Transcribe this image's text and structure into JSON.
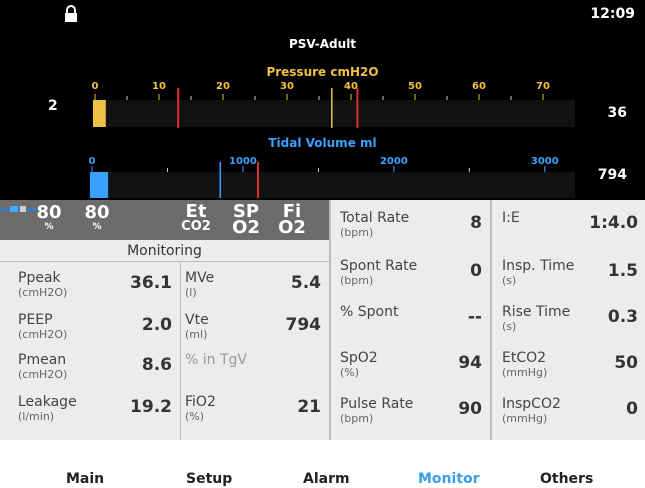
{
  "status": {
    "time": "12:09",
    "lock_icon": "lock-icon"
  },
  "mode": "PSV-Adult",
  "pressure_gauge": {
    "title": "Pressure cmH2O",
    "left_value": "2",
    "right_value": "36",
    "ticks": [
      "0",
      "10",
      "20",
      "30",
      "40",
      "50",
      "60",
      "70"
    ],
    "scale_max": 75,
    "bar_value": 2,
    "markers": [
      13,
      41
    ],
    "current_marker": 37,
    "color": "#f0c040",
    "marker_color": "#e03030"
  },
  "volume_gauge": {
    "title": "Tidal Volume ml",
    "right_value": "794",
    "ticks": [
      "0",
      "1000",
      "2000",
      "3000"
    ],
    "scale_max": 3200,
    "bar_value": 120,
    "markers": [
      1100
    ],
    "current_marker": 850,
    "color": "#3aa0ff",
    "marker_color": "#e03030"
  },
  "quickbar": {
    "item1": {
      "value": "80",
      "unit": "%"
    },
    "item2": {
      "value": "80",
      "unit": "%"
    },
    "sensor_icon": "sensor-icon",
    "etco2": {
      "top": "Et",
      "bottom": "CO2"
    },
    "spo2": {
      "top": "SP",
      "bottom": "O2"
    },
    "fio2": {
      "top": "Fi",
      "bottom": "O2"
    }
  },
  "monitoring_title": "Monitoring",
  "left_cells": {
    "ppeak": {
      "label": "Ppeak",
      "unit": "(cmH2O)",
      "value": "36.1"
    },
    "peep": {
      "label": "PEEP",
      "unit": "(cmH2O)",
      "value": "2.0"
    },
    "pmean": {
      "label": "Pmean",
      "unit": "(cmH2O)",
      "value": "8.6"
    },
    "leakage": {
      "label": "Leakage",
      "unit": "(l/min)",
      "value": "19.2"
    },
    "mve": {
      "label": "MVe",
      "unit": "(l)",
      "value": "5.4"
    },
    "vte": {
      "label": "Vte",
      "unit": "(ml)",
      "value": "794"
    },
    "tgv": {
      "label": "% in TgV",
      "unit": "",
      "value": ""
    },
    "fio2": {
      "label": "FiO2",
      "unit": "(%)",
      "value": "21"
    }
  },
  "mid_cells": {
    "total_rate": {
      "label": "Total Rate",
      "unit": "(bpm)",
      "value": "8"
    },
    "spont_rate": {
      "label": "Spont Rate",
      "unit": "(bpm)",
      "value": "0"
    },
    "pct_spont": {
      "label": "% Spont",
      "unit": "",
      "value": "--"
    },
    "spo2": {
      "label": "SpO2",
      "unit": "(%)",
      "value": "94"
    },
    "pulse_rate": {
      "label": "Pulse Rate",
      "unit": "(bpm)",
      "value": "90"
    }
  },
  "right_cells": {
    "ie": {
      "label": "I:E",
      "unit": "",
      "value": "1:4.0"
    },
    "insp_time": {
      "label": "Insp. Time",
      "unit": "(s)",
      "value": "1.5"
    },
    "rise_time": {
      "label": "Rise Time",
      "unit": "(s)",
      "value": "0.3"
    },
    "etco2": {
      "label": "EtCO2",
      "unit": "(mmHg)",
      "value": "50"
    },
    "inspco2": {
      "label": "InspCO2",
      "unit": "(mmHg)",
      "value": "0"
    }
  },
  "nav": {
    "main": "Main",
    "setup": "Setup",
    "alarm": "Alarm",
    "monitor": "Monitor",
    "others": "Others",
    "active": "Monitor",
    "active_color": "#3a9ee8"
  }
}
